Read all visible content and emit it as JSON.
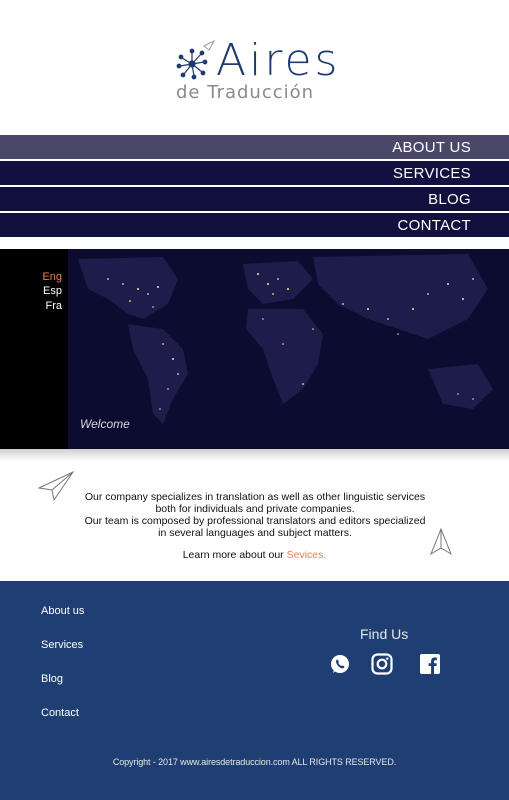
{
  "brand": {
    "name": "Aires",
    "subtitle": "de Traducción"
  },
  "nav": {
    "items": [
      {
        "label": "ABOUT US"
      },
      {
        "label": "SERVICES"
      },
      {
        "label": "BLOG"
      },
      {
        "label": "CONTACT"
      }
    ]
  },
  "hero": {
    "languages": [
      "Eng",
      "Esp",
      "Fra"
    ],
    "active_language": "Eng",
    "caption": "Welcome"
  },
  "intro": {
    "line1": "Our company specializes in translation as well as other linguistic services",
    "line2": "both for individuals and private companies.",
    "line3": "Our team is composed by  professional translators and editors specialized",
    "line4": "in several languages and subject matters.",
    "learn_prefix": "Learn more about our ",
    "learn_link": "Sevices."
  },
  "footer": {
    "links": [
      "About us",
      "Services",
      "Blog",
      "Contact"
    ],
    "find_us": "Find Us",
    "social": [
      "whatsapp-icon",
      "instagram-icon",
      "facebook-icon"
    ],
    "copyright": "Copyright - 2017 www.airesdetraduccion.com ALL RIGHTS RESERVED."
  },
  "colors": {
    "nav_bg": "#12103e",
    "nav_active": "#4a4769",
    "accent": "#e8824a",
    "footer_bg": "#1f3f73",
    "brand_blue": "#1f3a6e"
  }
}
